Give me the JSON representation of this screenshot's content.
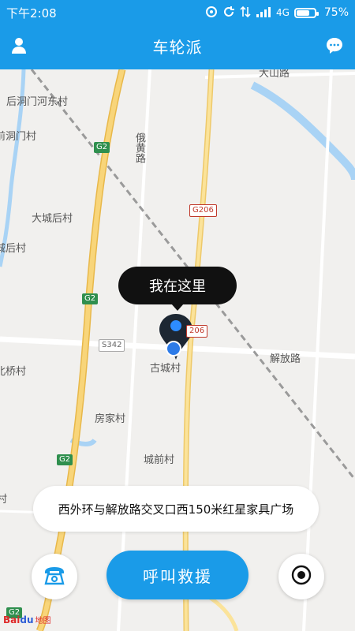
{
  "status_bar": {
    "time": "下午2:08",
    "network": "4G",
    "battery": "75%",
    "battery_fraction": 0.75
  },
  "header": {
    "title": "车轮派",
    "left_icon": "user-icon",
    "right_icon": "chat-icon"
  },
  "map": {
    "labels": {
      "village_houdong": "后洞门河东村",
      "village_qiandong": "前洞门村",
      "village_dacheng": "大城后村",
      "village_chenghou": "城后村",
      "village_beiqiao": "北桥村",
      "village_gucheng": "古城村",
      "village_fangjia": "房家村",
      "village_chengqian": "城前村",
      "village_edge": "村",
      "road_ehuang": "俄黄路",
      "road_jiefang": "解放路",
      "road_dashan": "大山路"
    },
    "shields": {
      "g2_1": "G2",
      "g2_2": "G2",
      "g2_3": "G2",
      "g2_4": "G2",
      "g206_1": "G206",
      "g206_2": "206",
      "s342": "S342"
    },
    "marker_label": "我在这里",
    "brand": {
      "part1": "Bai",
      "part2": "du",
      "part3": "地图"
    }
  },
  "location": {
    "address": "西外环与解放路交叉口西150米红星家具广场"
  },
  "actions": {
    "call_icon": "phone-icon",
    "rescue_label": "呼叫救援",
    "locate_icon": "locate-icon"
  },
  "colors": {
    "primary": "#1a9be8",
    "marker": "#1a73e8",
    "bubble": "#111111"
  }
}
